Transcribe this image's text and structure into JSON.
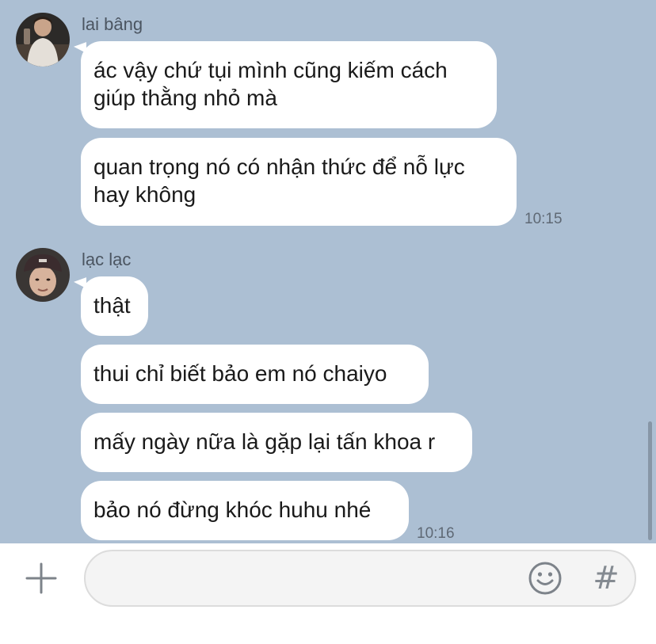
{
  "conversation": {
    "groups": [
      {
        "sender": "lai bâng",
        "messages": [
          {
            "lines": [
              "ác vậy chứ tụi mình cũng kiếm cách",
              "giúp thằng nhỏ mà"
            ]
          },
          {
            "lines": [
              "quan trọng nó có nhận thức để nỗ lực",
              "hay không"
            ],
            "time": "10:15"
          }
        ]
      },
      {
        "sender": "lạc lạc",
        "messages": [
          {
            "lines": [
              "thật"
            ]
          },
          {
            "lines": [
              "thui chỉ biết bảo em nó chaiyo"
            ]
          },
          {
            "lines": [
              "mấy ngày nữa là gặp lại tấn khoa r"
            ]
          },
          {
            "lines": [
              "bảo nó đừng khóc huhu nhé"
            ],
            "time": "10:16"
          }
        ]
      }
    ]
  },
  "composer": {
    "placeholder": "",
    "plus_icon": "plus-icon",
    "emoji_icon": "smiley-icon",
    "hash_label": "#"
  },
  "colors": {
    "chat_background": "#acbfd3",
    "bubble": "#ffffff",
    "input_bar": "#ffffff"
  }
}
